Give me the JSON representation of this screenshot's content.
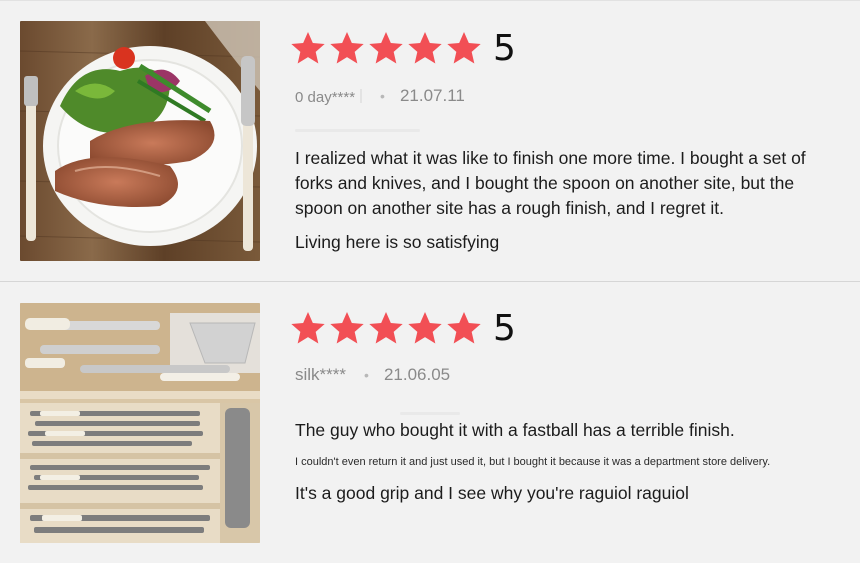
{
  "reviews": [
    {
      "rating_stars": 5,
      "score": "5",
      "author": "0 day****",
      "date": "21.07.11",
      "paragraphs": [
        "I realized what it was like to finish one more time. I bought a set of forks and knives, and I bought the spoon on another site, but the spoon on another site has a rough finish, and I regret it.",
        "Living here is so satisfying"
      ]
    },
    {
      "rating_stars": 5,
      "score": "5",
      "author": "silk****",
      "date": "21.06.05",
      "paragraphs": [
        "The guy who bought it with a fastball has a terrible finish.",
        "I couldn't even return it and just used it, but I bought it because it was a department store delivery.",
        "It's a good grip and I see why you're raguiol raguiol"
      ]
    }
  ],
  "colors": {
    "star": "#f24f55",
    "background": "#f2f2f2",
    "meta_text": "#8a8a8a",
    "body_text": "#1c1c1c"
  },
  "icons": {
    "rating": "star-icon",
    "separator": "dot-separator"
  }
}
